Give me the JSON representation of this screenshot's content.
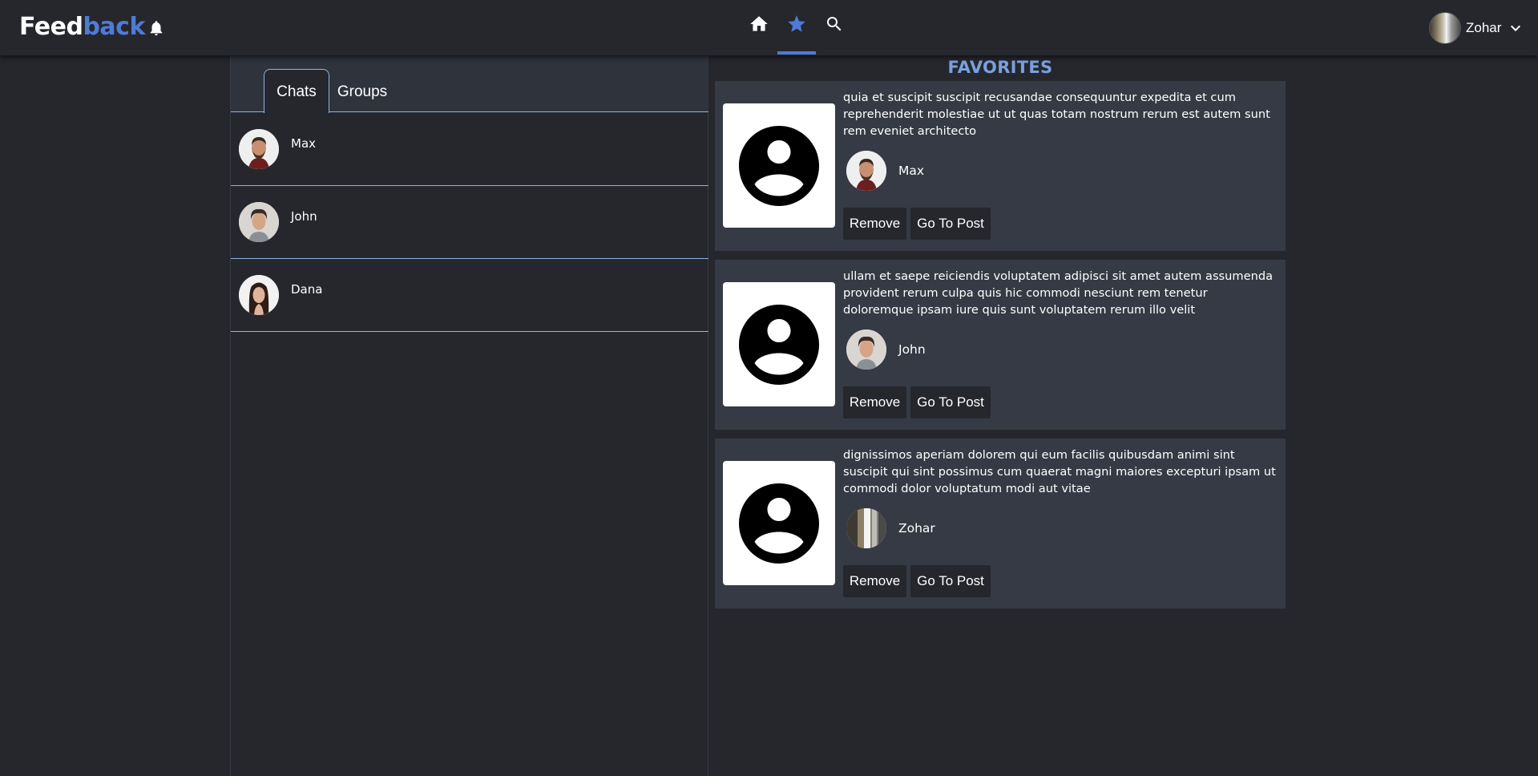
{
  "header": {
    "logo_part1": "Feed",
    "logo_part2": "back",
    "icons": [
      "bell-icon",
      "home-icon",
      "star-icon",
      "search-icon",
      "chevron-down-icon"
    ],
    "active_nav": "favorites",
    "user_name": "Zohar",
    "accent_color": "#4f7bd6"
  },
  "sidebar": {
    "tabs": [
      {
        "label": "Chats",
        "active": true
      },
      {
        "label": "Groups",
        "active": false
      }
    ],
    "chats": [
      {
        "name": "Max"
      },
      {
        "name": "John"
      },
      {
        "name": "Dana"
      }
    ]
  },
  "favorites": {
    "title": "FAVORITES",
    "posts": [
      {
        "text": "quia et suscipit suscipit recusandae consequuntur expedita et cum reprehenderit molestiae ut ut quas totam nostrum rerum est autem sunt rem eveniet architecto",
        "author": "Max",
        "remove_label": "Remove",
        "goto_label": "Go To Post"
      },
      {
        "text": "ullam et saepe reiciendis voluptatem adipisci sit amet autem assumenda provident rerum culpa quis hic commodi nesciunt rem tenetur doloremque ipsam iure quis sunt voluptatem rerum illo velit",
        "author": "John",
        "remove_label": "Remove",
        "goto_label": "Go To Post"
      },
      {
        "text": "dignissimos aperiam dolorem qui eum facilis quibusdam animi sint suscipit qui sint possimus cum quaerat magni maiores excepturi ipsam ut commodi dolor voluptatum modi aut vitae",
        "author": "Zohar",
        "remove_label": "Remove",
        "goto_label": "Go To Post"
      }
    ]
  }
}
